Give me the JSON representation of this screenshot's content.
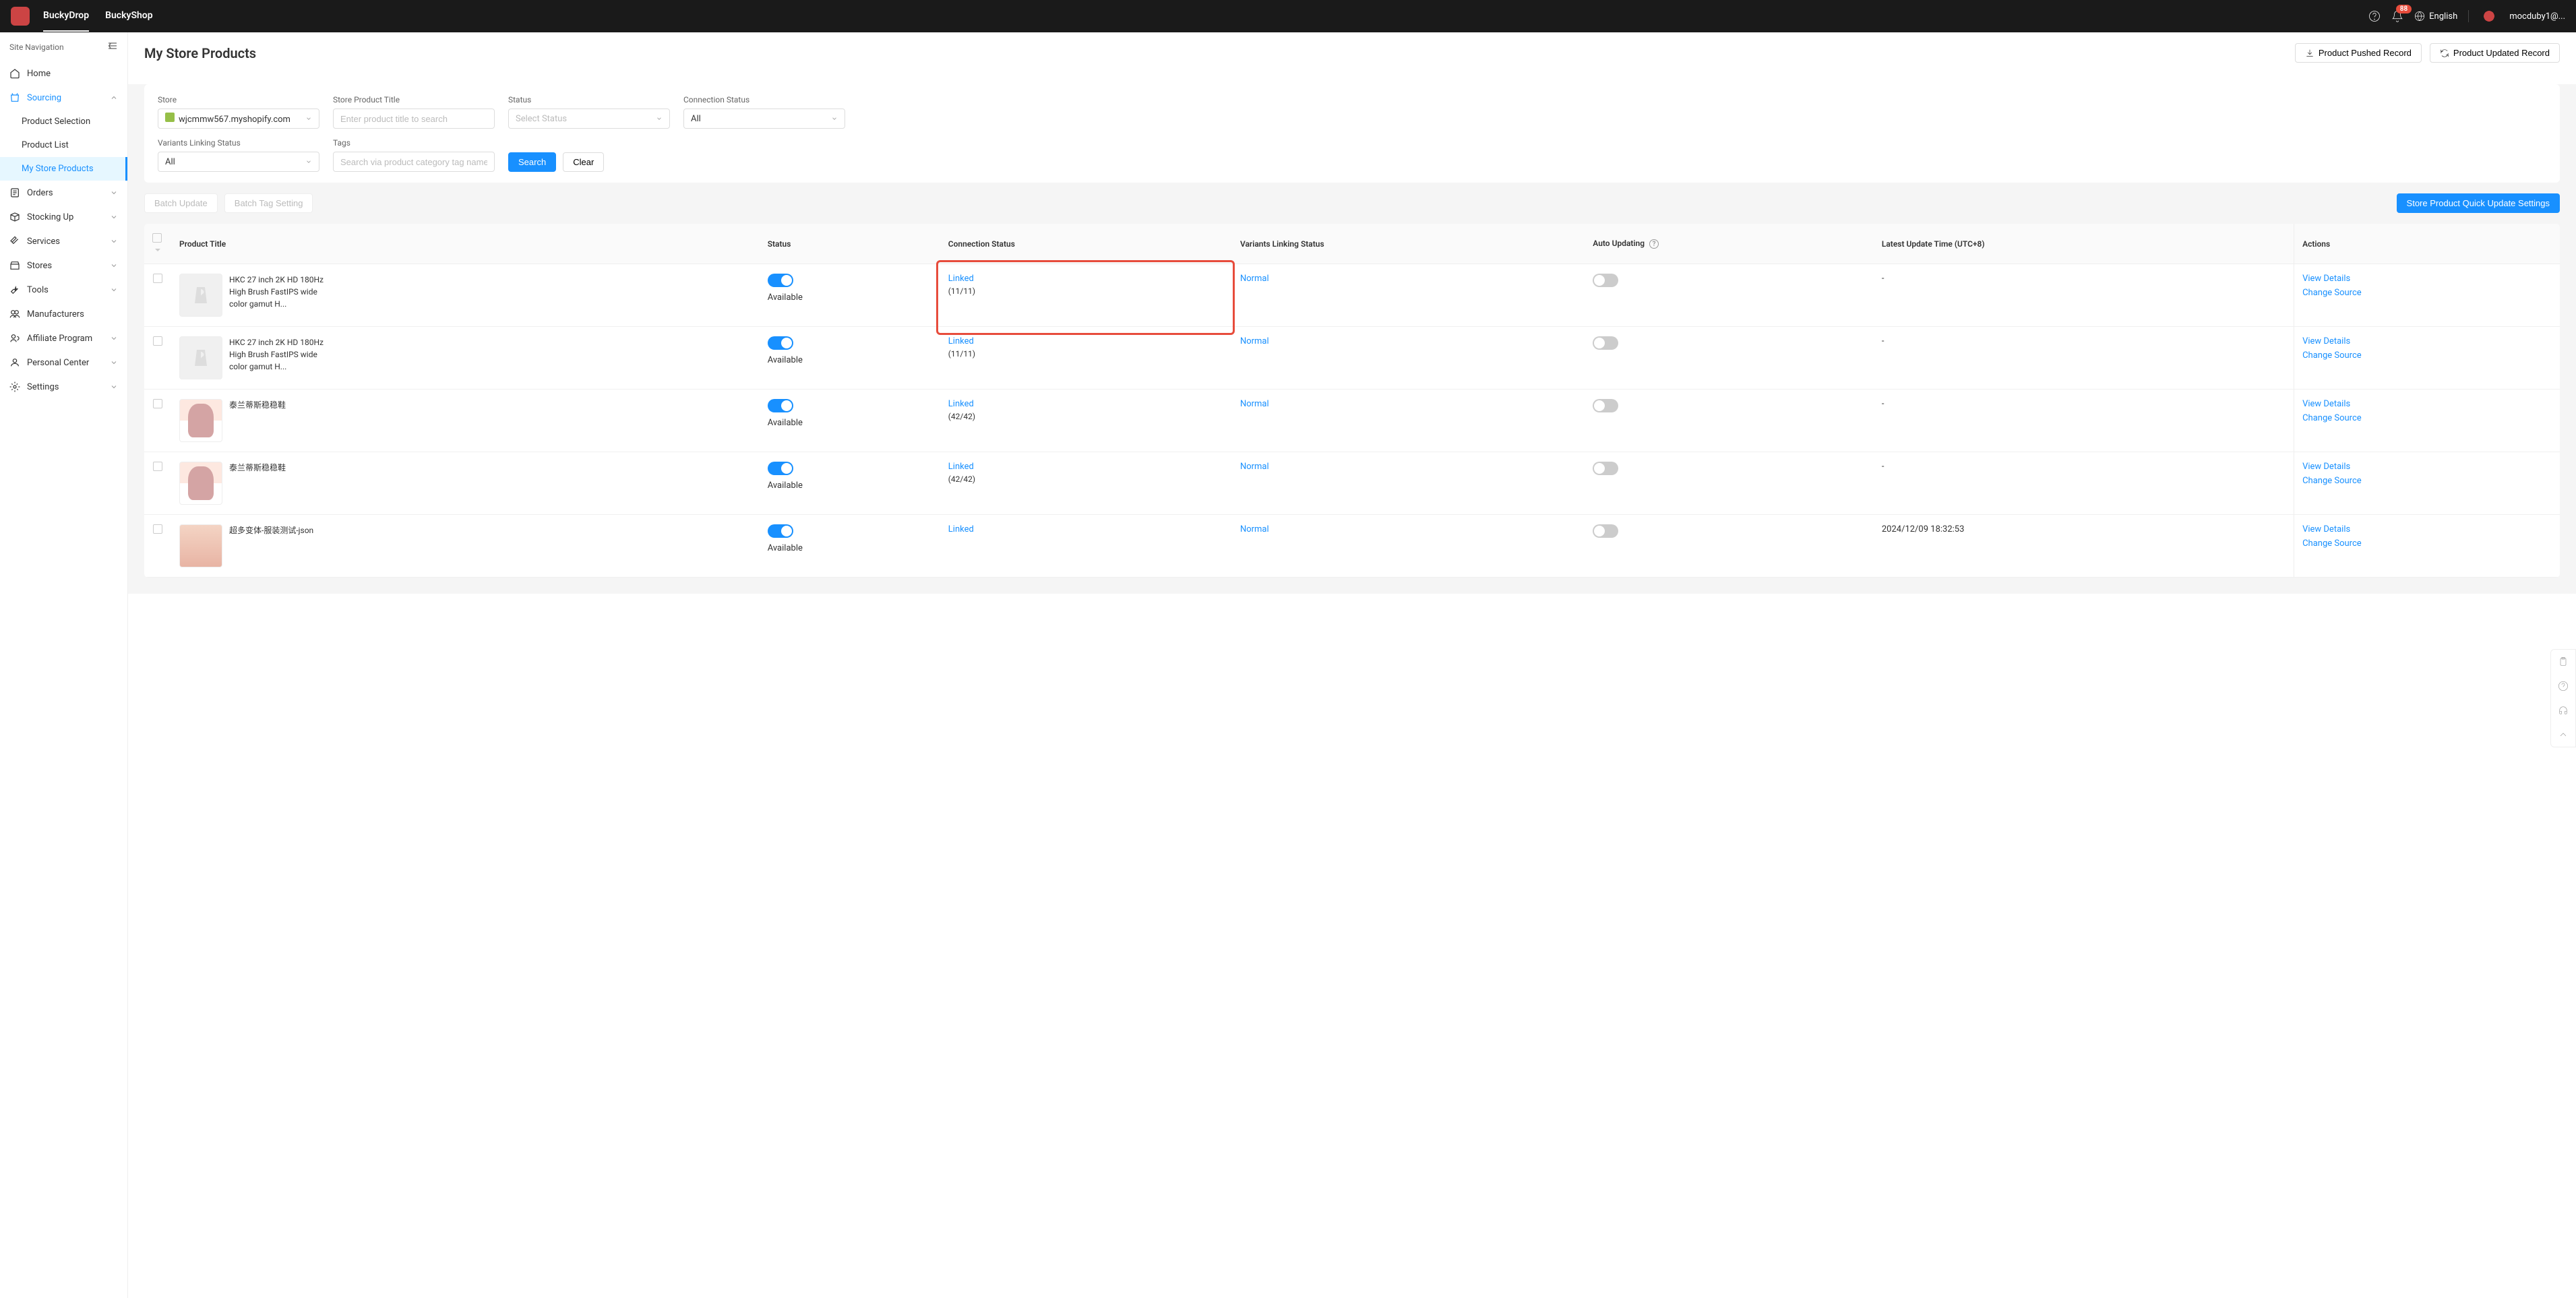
{
  "header": {
    "tabs": [
      "BuckyDrop",
      "BuckyShop"
    ],
    "notifications": "88",
    "language": "English",
    "user": "mocduby1@..."
  },
  "sidebar": {
    "title": "Site Navigation",
    "items": {
      "home": "Home",
      "sourcing": "Sourcing",
      "productSelection": "Product Selection",
      "productList": "Product List",
      "myStoreProducts": "My Store Products",
      "orders": "Orders",
      "stockingUp": "Stocking Up",
      "services": "Services",
      "stores": "Stores",
      "tools": "Tools",
      "manufacturers": "Manufacturers",
      "affiliateProgram": "Affiliate Program",
      "personalCenter": "Personal Center",
      "settings": "Settings"
    }
  },
  "page": {
    "title": "My Store Products",
    "pushedRecord": "Product Pushed Record",
    "updatedRecord": "Product Updated Record"
  },
  "filters": {
    "store": {
      "label": "Store",
      "value": "wjcmmw567.myshopify.com"
    },
    "productTitle": {
      "label": "Store Product Title",
      "placeholder": "Enter product title to search"
    },
    "status": {
      "label": "Status",
      "placeholder": "Select Status"
    },
    "connectionStatus": {
      "label": "Connection Status",
      "value": "All"
    },
    "variantsLinking": {
      "label": "Variants Linking Status",
      "value": "All"
    },
    "tags": {
      "label": "Tags",
      "placeholder": "Search via product category tag name"
    },
    "search": "Search",
    "clear": "Clear"
  },
  "toolbar": {
    "batchUpdate": "Batch Update",
    "batchTag": "Batch Tag Setting",
    "quickUpdate": "Store Product Quick Update Settings"
  },
  "table": {
    "headers": {
      "productTitle": "Product Title",
      "status": "Status",
      "connectionStatus": "Connection Status",
      "variantsLinking": "Variants Linking Status",
      "autoUpdating": "Auto Updating",
      "latestUpdate": "Latest Update Time (UTC+8)",
      "actions": "Actions"
    },
    "statusAvailable": "Available",
    "linked": "Linked",
    "normal": "Normal",
    "viewDetails": "View Details",
    "changeSource": "Change Source",
    "rows": [
      {
        "title": "HKC 27 inch 2K HD 180Hz High Brush FastIPS wide color gamut H...",
        "count": "(11/11)",
        "latest": "-",
        "img": "placeholder"
      },
      {
        "title": "HKC 27 inch 2K HD 180Hz High Brush FastIPS wide color gamut H...",
        "count": "(11/11)",
        "latest": "-",
        "img": "placeholder"
      },
      {
        "title": "泰兰蒂斯稳稳鞋",
        "count": "(42/42)",
        "latest": "-",
        "img": "thumb"
      },
      {
        "title": "泰兰蒂斯稳稳鞋",
        "count": "(42/42)",
        "latest": "-",
        "img": "thumb"
      },
      {
        "title": "超多变体-服装测试-json",
        "count": "",
        "latest": "2024/12/09 18:32:53",
        "img": "thumb2"
      }
    ]
  }
}
